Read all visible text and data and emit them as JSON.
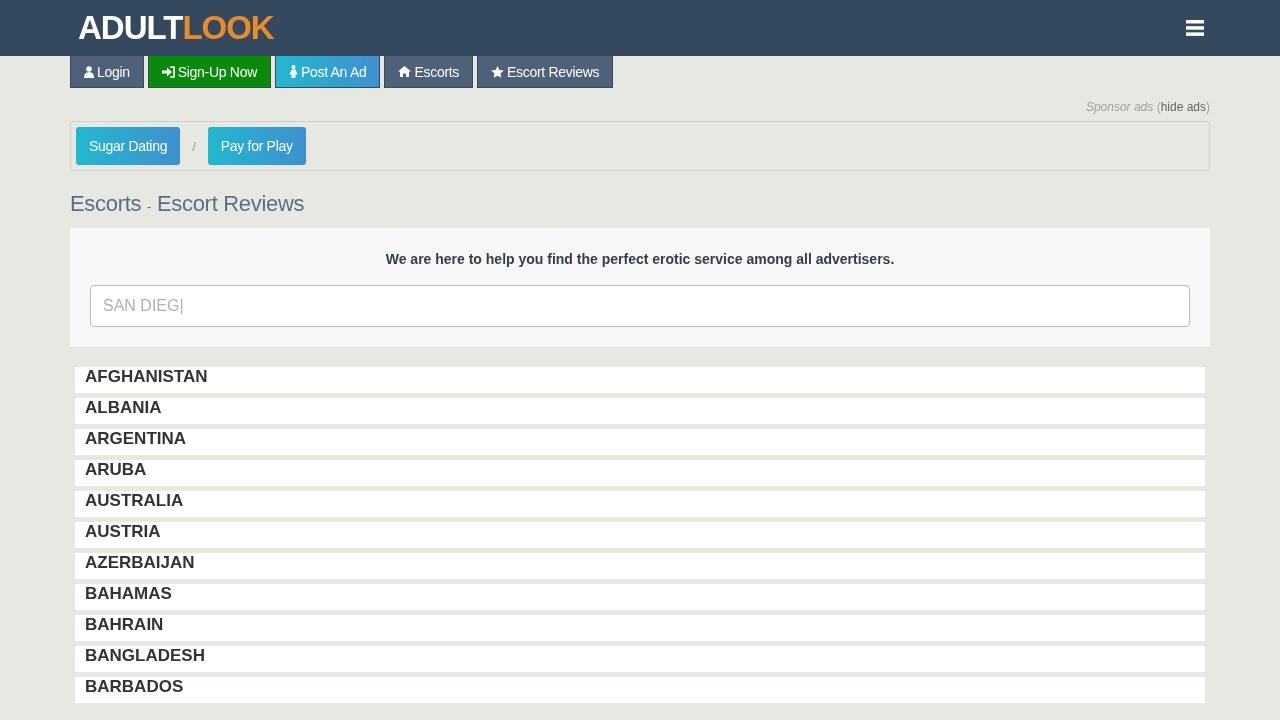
{
  "header": {
    "logo": {
      "first": "ADULT",
      "second": "LOOK"
    }
  },
  "nav": [
    {
      "label": "Login",
      "kind": "user"
    },
    {
      "label": "Sign-Up Now",
      "kind": "signup"
    },
    {
      "label": "Post An Ad",
      "kind": "post"
    },
    {
      "label": "Escorts",
      "kind": "home"
    },
    {
      "label": "Escort Reviews",
      "kind": "star"
    }
  ],
  "sponsor": {
    "label": "Sponsor ads",
    "open": "(",
    "link": "hide ads",
    "close": ")"
  },
  "sponsor_links": [
    "Sugar Dating",
    "Pay for Play"
  ],
  "sponsor_separator": "/",
  "breadcrumb": {
    "first": "Escorts",
    "separator": "-",
    "second": "Escort Reviews"
  },
  "search_panel": {
    "intro": "We are here to help you find the perfect erotic service among all advertisers.",
    "placeholder": "SAN DIEG|"
  },
  "countries": [
    "AFGHANISTAN",
    "ALBANIA",
    "ARGENTINA",
    "ARUBA",
    "AUSTRALIA",
    "AUSTRIA",
    "AZERBAIJAN",
    "BAHAMAS",
    "BAHRAIN",
    "BANGLADESH",
    "BARBADOS"
  ]
}
